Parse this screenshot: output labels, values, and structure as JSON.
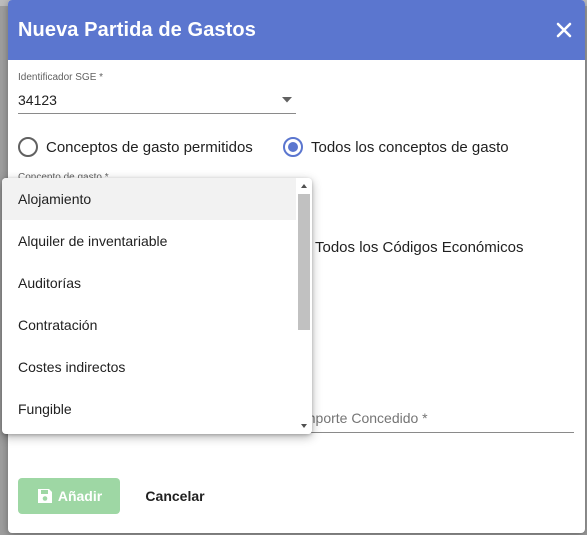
{
  "dialog": {
    "title": "Nueva Partida de Gastos",
    "colors": {
      "header": "#5b76cf",
      "save_button": "#9ed7a4"
    }
  },
  "identificador": {
    "label": "Identificador SGE *",
    "value": "34123"
  },
  "radio_conceptos": {
    "option_permitidos": "Conceptos de gasto permitidos",
    "option_todos": "Todos los conceptos de gasto",
    "selected": "Todos los conceptos de gasto"
  },
  "concepto_field": {
    "label": "Concepto de gasto *"
  },
  "codigos_radio": {
    "label": "Todos los Códigos Económicos"
  },
  "importe_field": {
    "placeholder": "Importe Concedido *"
  },
  "dropdown": {
    "options": [
      "Alojamiento",
      "Alquiler de inventariable",
      "Auditorías",
      "Contratación",
      "Costes indirectos",
      "Fungible"
    ],
    "highlighted": "Alojamiento"
  },
  "actions": {
    "save_label": "Añadir",
    "cancel_label": "Cancelar"
  },
  "icons": {
    "close": "close-icon",
    "save": "floppy-disk-icon",
    "dropdown_arrow": "caret-down-icon"
  }
}
